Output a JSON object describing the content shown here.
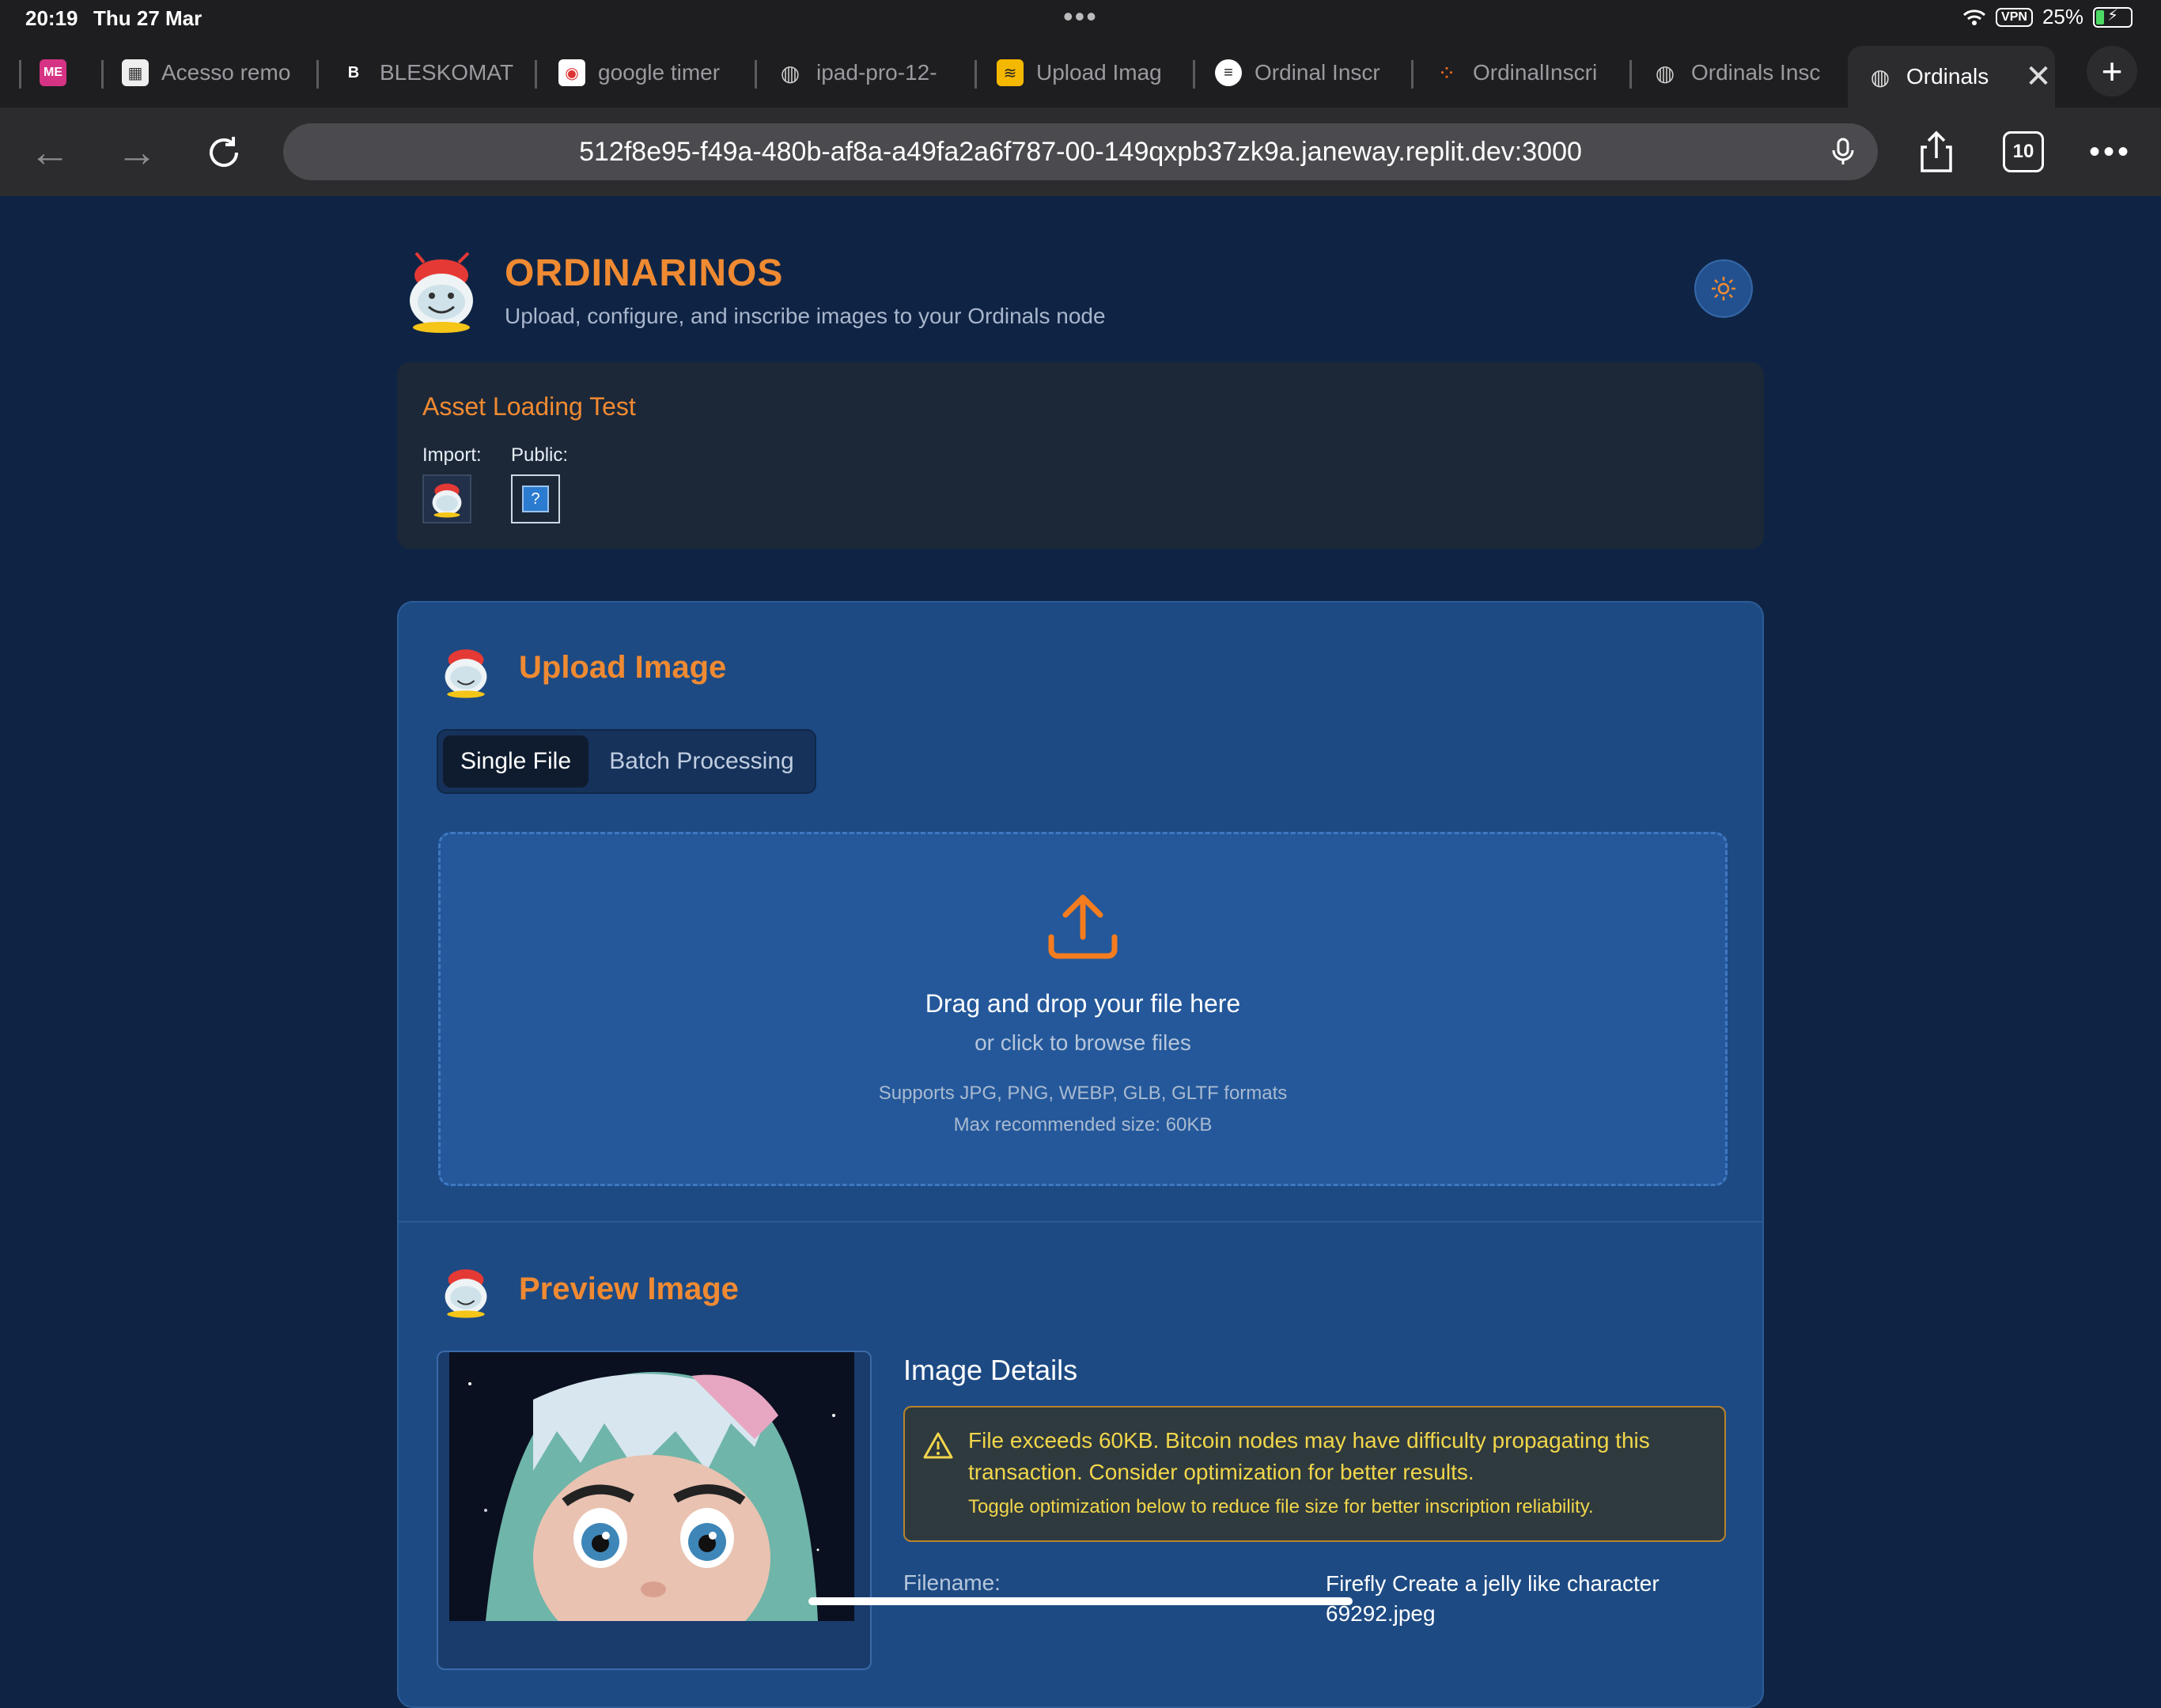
{
  "status_bar": {
    "time": "20:19",
    "date": "Thu 27 Mar",
    "vpn": "VPN",
    "battery": "25%"
  },
  "tabs": [
    {
      "label": "",
      "icon": "me-icon"
    },
    {
      "label": "Acesso remo",
      "icon": "image-icon"
    },
    {
      "label": "BLESKOMAT",
      "icon": "bleskomat-icon"
    },
    {
      "label": "google timer",
      "icon": "google-icon"
    },
    {
      "label": "ipad-pro-12-",
      "icon": "globe-icon"
    },
    {
      "label": "Upload Imag",
      "icon": "stack-icon"
    },
    {
      "label": "Ordinal Inscr",
      "icon": "lines-icon"
    },
    {
      "label": "OrdinalInscri",
      "icon": "dots-icon"
    },
    {
      "label": "Ordinals Insc",
      "icon": "globe-icon"
    },
    {
      "label": "Ordinals",
      "icon": "globe-icon",
      "active": true
    }
  ],
  "toolbar": {
    "url": "512f8e95-f49a-480b-af8a-a49fa2a6f787-00-149qxpb37zk9a.janeway.replit.dev:3000",
    "tab_count": "10"
  },
  "header": {
    "title": "ORDINARINOS",
    "subtitle": "Upload, configure, and inscribe images to your Ordinals node"
  },
  "asset_test": {
    "title": "Asset Loading Test",
    "import_label": "Import:",
    "public_label": "Public:",
    "public_placeholder": "?"
  },
  "upload": {
    "title": "Upload Image",
    "tabs": {
      "single": "Single File",
      "batch": "Batch Processing"
    },
    "dropzone": {
      "main": "Drag and drop your file here",
      "sub": "or click to browse files",
      "formats": "Supports JPG, PNG, WEBP, GLB, GLTF formats",
      "max": "Max recommended size: 60KB"
    }
  },
  "preview": {
    "title": "Preview Image",
    "details_title": "Image Details",
    "warning_main": "File exceeds 60KB. Bitcoin nodes may have difficulty propagating this transaction. Consider optimization for better results.",
    "warning_sub": "Toggle optimization below to reduce file size for better inscription reliability.",
    "filename_label": "Filename:",
    "filename_value": "Firefly Create a jelly like character 69292.jpeg"
  },
  "colors": {
    "accent": "#f08a32",
    "page_bg": "#0f2444",
    "card_bg": "#1d4a83",
    "warning": "#f2d64b"
  }
}
